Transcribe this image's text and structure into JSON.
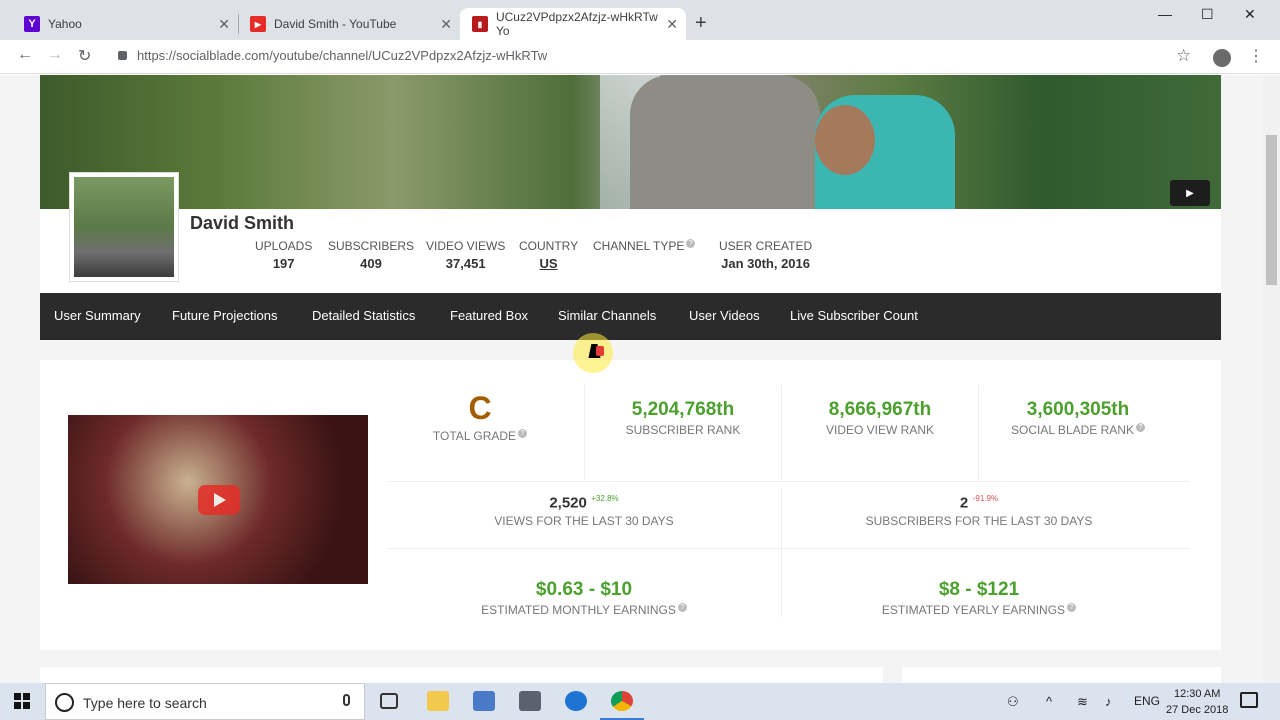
{
  "browser": {
    "tabs": [
      {
        "title": "Yahoo",
        "favicon": "Y",
        "favicon_color": "#5f01d1"
      },
      {
        "title": "David Smith - YouTube",
        "favicon": "▶",
        "favicon_color": "#e52d27"
      },
      {
        "title": "UCuz2VPdpzx2Afzjz-wHkRTw Yo",
        "favicon": "▮",
        "favicon_color": "#b71c1c"
      }
    ],
    "url": "https://socialblade.com/youtube/channel/UCuz2VPdpzx2Afzjz-wHkRTw"
  },
  "channel": {
    "name": "David Smith",
    "stats": [
      {
        "label": "UPLOADS",
        "value": "197"
      },
      {
        "label": "SUBSCRIBERS",
        "value": "409"
      },
      {
        "label": "VIDEO VIEWS",
        "value": "37,451"
      },
      {
        "label": "COUNTRY",
        "value": "US"
      },
      {
        "label": "CHANNEL TYPE",
        "value": ""
      },
      {
        "label": "USER CREATED",
        "value": "Jan 30th, 2016"
      }
    ]
  },
  "nav": [
    "User Summary",
    "Future Projections",
    "Detailed Statistics",
    "Featured Box",
    "Similar Channels",
    "User Videos",
    "Live Subscriber Count"
  ],
  "summary": {
    "grade": "C",
    "grade_label": "TOTAL GRADE",
    "subscriber_rank": "5,204,768th",
    "subscriber_rank_label": "SUBSCRIBER RANK",
    "video_view_rank": "8,666,967th",
    "video_view_rank_label": "VIDEO VIEW RANK",
    "social_blade_rank": "3,600,305th",
    "social_blade_rank_label": "SOCIAL BLADE RANK",
    "views_30": "2,520",
    "views_30_change": "+32.8%",
    "views_30_label": "VIEWS FOR THE LAST 30 DAYS",
    "subs_30": "2",
    "subs_30_change": "-91.9%",
    "subs_30_label": "SUBSCRIBERS FOR THE LAST 30 DAYS",
    "monthly_earnings": "$0.63 - $10",
    "monthly_earnings_label": "ESTIMATED MONTHLY EARNINGS",
    "yearly_earnings": "$8 - $121",
    "yearly_earnings_label": "ESTIMATED YEARLY EARNINGS"
  },
  "taskbar": {
    "search_placeholder": "Type here to search",
    "language": "ENG",
    "time": "12:30 AM",
    "date": "27 Dec 2018"
  }
}
